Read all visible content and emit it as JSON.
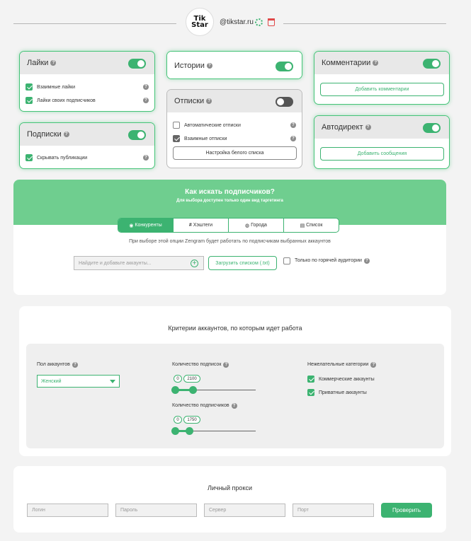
{
  "header": {
    "logo_text": "Tik Star",
    "username": "@tikstar.ru"
  },
  "likes": {
    "title": "Лайки",
    "enabled": true,
    "items": [
      "Взаимные лайки",
      "Лайки своих подписчиков"
    ]
  },
  "follows": {
    "title": "Подписки",
    "enabled": true,
    "items": [
      "Скрывать публикации"
    ]
  },
  "stories": {
    "title": "Истории",
    "enabled": true
  },
  "unfollows": {
    "title": "Отписки",
    "enabled": false,
    "items": [
      "Автоматические отписки",
      "Взаимные отписки"
    ],
    "whitelist_button": "Настройка белого списка"
  },
  "comments": {
    "title": "Комментарии",
    "enabled": true,
    "add_button": "Добавить комментарии"
  },
  "autodirect": {
    "title": "Автодирект",
    "enabled": true,
    "add_button": "Добавить сообщения"
  },
  "targeting": {
    "title": "Как искать подписчиков?",
    "subtitle": "Для выбора доступен только один вид таргетинга",
    "tabs": [
      "Конкуренты",
      "Хэштеги",
      "Города",
      "Список"
    ],
    "active_tab": "Конкуренты",
    "description": "При выборе этой опции Zengram будет работать по подписчикам выбранных аккаунтов",
    "search_placeholder": "Найдите и добавьте аккаунты...",
    "upload_button": "Загрузить списком (.txt)",
    "hot_audience_label": "Только по горячей аудитории"
  },
  "criteria": {
    "title": "Критерии аккаунтов, по которым идет работа",
    "gender_label": "Пол аккаунтов",
    "gender_value": "Женский",
    "following_label": "Количество подписок",
    "following_min": "0",
    "following_max": "2100",
    "followers_label": "Количество подписчиков",
    "followers_min": "0",
    "followers_max": "1750",
    "unwanted_label": "Нежелательные категории",
    "unwanted_items": [
      "Коммерческие аккаунты",
      "Приватные аккаунты"
    ]
  },
  "proxy": {
    "title": "Личный прокси",
    "login_placeholder": "Логин",
    "password_placeholder": "Пароль",
    "server_placeholder": "Сервер",
    "port_placeholder": "Порт",
    "check_button": "Проверить"
  },
  "colors": {
    "accent": "#3cb371",
    "header_green": "#6fce8f"
  }
}
